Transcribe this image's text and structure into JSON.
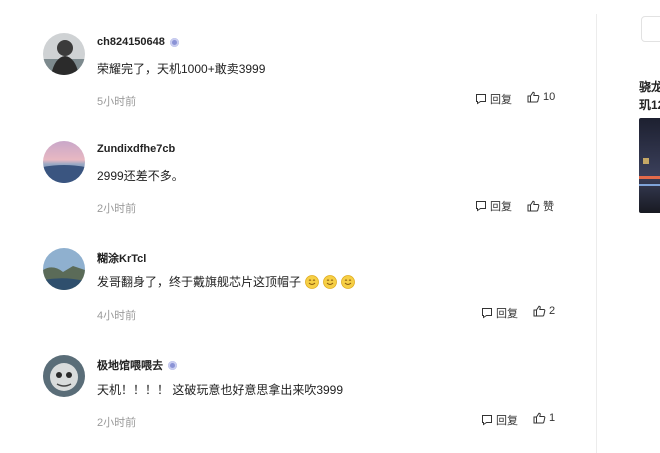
{
  "comments": [
    {
      "username": "ch824150648",
      "verified": true,
      "text": "荣耀完了，天机1000+敢卖3999",
      "time": "5小时前",
      "reply_label": "回复",
      "like_label": "10"
    },
    {
      "username": "Zundixdfhe7cb",
      "verified": false,
      "text": "2999还差不多。",
      "time": "2小时前",
      "reply_label": "回复",
      "like_label": "赞"
    },
    {
      "username": "糊涂KrTcl",
      "verified": false,
      "text": "发哥翻身了，终于戴旗舰芯片这顶帽子",
      "emojis": [
        "smile-emoji",
        "smile-emoji",
        "smile-emoji"
      ],
      "time": "4小时前",
      "reply_label": "回复",
      "like_label": "2"
    },
    {
      "username": "极地馆喂喂去",
      "verified": true,
      "text": "天机！！！！ 这破玩意也好意思拿出来吹3999",
      "time": "2小时前",
      "reply_label": "回复",
      "like_label": "1"
    }
  ],
  "sidebar": {
    "tab_label": "",
    "article_title_line1": "骁龙",
    "article_title_line2": "玑12"
  },
  "colors": {
    "text": "#222222",
    "muted": "#9a9a9a",
    "verified": "#8b93d6",
    "divider": "#ececec"
  }
}
